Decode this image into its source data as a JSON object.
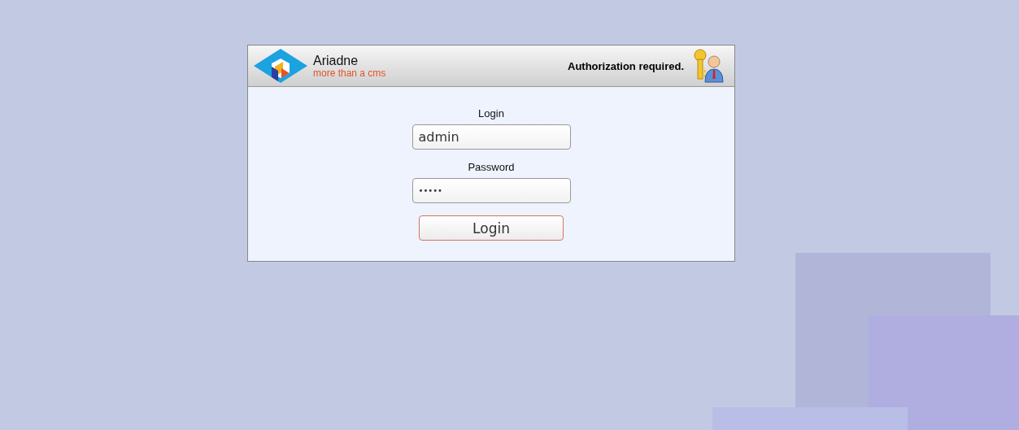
{
  "header": {
    "brand": "Ariadne",
    "tagline": "more than a cms",
    "notice": "Authorization required."
  },
  "form": {
    "fields": [
      {
        "label": "Login",
        "value": "admin",
        "kind": "text"
      },
      {
        "label": "Password",
        "value": "•••••",
        "kind": "password"
      }
    ],
    "submit": "Login"
  }
}
